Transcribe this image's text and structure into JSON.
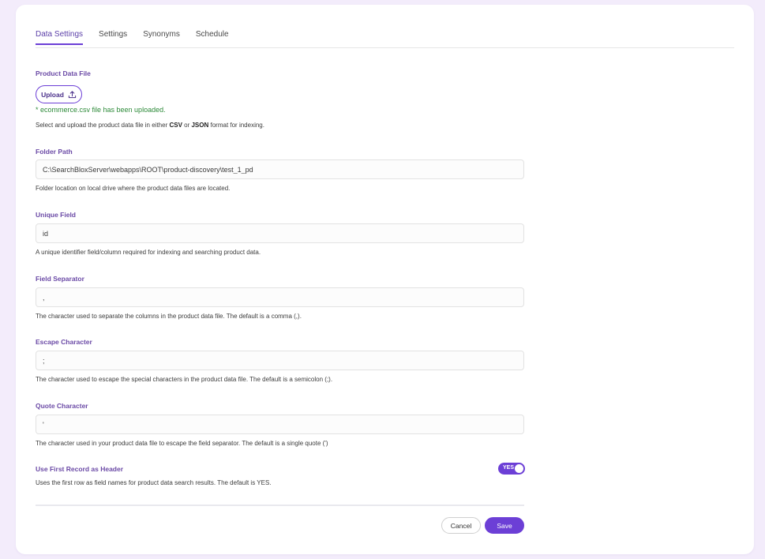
{
  "tabs": [
    {
      "label": "Data Settings",
      "active": true
    },
    {
      "label": "Settings",
      "active": false
    },
    {
      "label": "Synonyms",
      "active": false
    },
    {
      "label": "Schedule",
      "active": false
    }
  ],
  "product_file": {
    "label": "Product Data File",
    "upload_label": "Upload",
    "uploaded_message": "* ecommerce.csv file has been uploaded.",
    "help_prefix": "Select and upload the product data file in either ",
    "help_csv": "CSV",
    "help_or": " or ",
    "help_json": "JSON",
    "help_suffix": " format for indexing."
  },
  "folder_path": {
    "label": "Folder Path",
    "value": "C:\\SearchBloxServer\\webapps\\ROOT\\product-discovery\\test_1_pd",
    "help": "Folder location on local drive where the product data files are located."
  },
  "unique_field": {
    "label": "Unique Field",
    "value": "id",
    "help": "A unique identifier field/column required for indexing and searching product data."
  },
  "field_separator": {
    "label": "Field Separator",
    "value": ",",
    "help": "The character used to separate the columns in the product data file. The default is a comma (,)."
  },
  "escape_character": {
    "label": "Escape Character",
    "value": ";",
    "help": "The character used to escape the special characters in the product data file. The default is a semicolon (;)."
  },
  "quote_character": {
    "label": "Quote Character",
    "value": "'",
    "help": "The character used in your product data file to escape the field separator. The default is a single quote (')"
  },
  "header_record": {
    "label": "Use First Record as Header",
    "toggle_label": "YES",
    "enabled": true,
    "help": "Uses the first row as field names for product data search results. The default is YES."
  },
  "actions": {
    "cancel_label": "Cancel",
    "save_label": "Save"
  },
  "colors": {
    "accent": "#6c3fd6",
    "label": "#6b4aa6",
    "success": "#2e8b3a",
    "background": "#f3ecfb"
  },
  "icons": {
    "upload": "upload-arrow-icon"
  }
}
